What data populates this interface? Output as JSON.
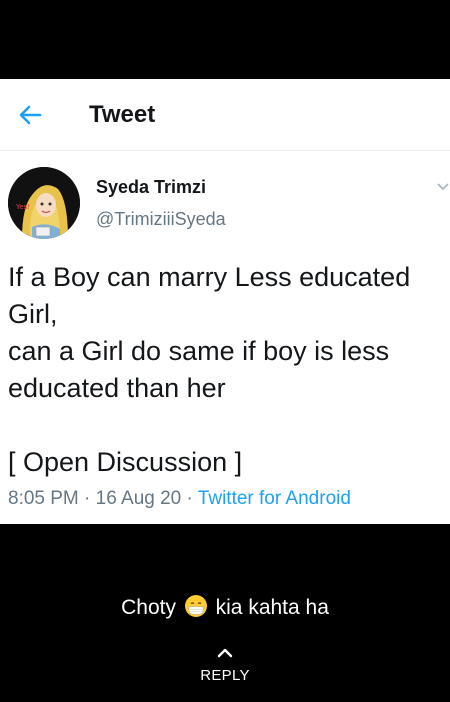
{
  "app_bar": {
    "title": "Tweet"
  },
  "tweet": {
    "author_name": "Syeda Trimzi",
    "author_handle": "@TrimiziiiSyeda",
    "text_lines": [
      "If a Boy can marry Less educated",
      "Girl,",
      "can a Girl do same if boy is less",
      "educated than her",
      "",
      "[ Open Discussion ]"
    ],
    "time": "8:05 PM",
    "separator": " · ",
    "date": "16 Aug 20",
    "source": "Twitter for Android",
    "avatar_mark_text": "Yes!"
  },
  "status": {
    "caption_before": "Choty",
    "caption_emoji": "mask-face-emoji",
    "caption_after": "kia kahta ha",
    "reply_label": "REPLY"
  },
  "colors": {
    "accent": "#1da1f2",
    "secondary_text": "#657786",
    "primary_text": "#14171a",
    "background": "#000000",
    "card": "#ffffff"
  }
}
